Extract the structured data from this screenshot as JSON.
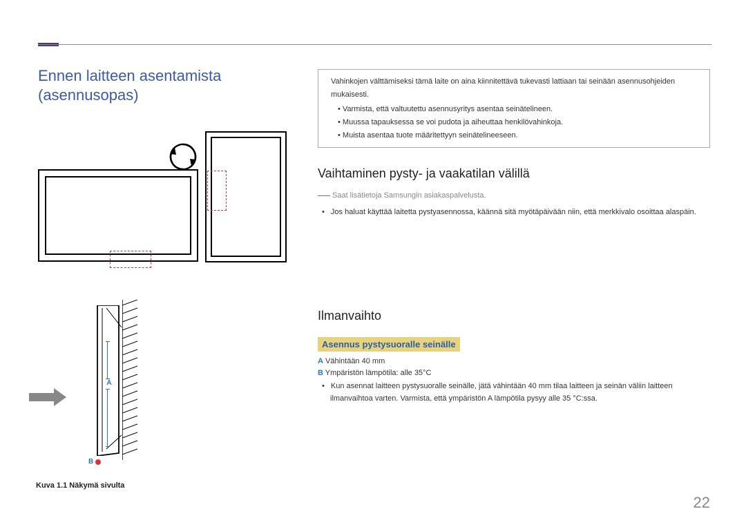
{
  "page": {
    "title": "Ennen laitteen asentamista (asennusopas)",
    "number": "22"
  },
  "left": {
    "labelA": "A",
    "labelB": "B",
    "caption": "Kuva 1.1 Näkymä sivulta"
  },
  "right": {
    "warn": {
      "main": "Vahinkojen välttämiseksi tämä laite on aina kiinnitettävä tukevasti lattiaan tai seinään asennusohjeiden mukaisesti.",
      "b1": "Varmista, että valtuutettu asennusyritys asentaa seinätelineen.",
      "b2": "Muussa tapauksessa se voi pudota ja aiheuttaa henkilövahinkoja.",
      "b3": "Muista asentaa tuote määritettyyn seinätelineeseen."
    },
    "sec1": {
      "h2": "Vaihtaminen pysty- ja vaakatilan välillä",
      "note": "Saat lisätietoja Samsungin asiakaspalvelusta.",
      "b1": "Jos haluat käyttää laitetta pystyasennossa, käännä sitä myötäpäivään niin, että merkkivalo osoittaa alaspäin."
    },
    "sec2": {
      "h2": "Ilmanvaihto",
      "sub": "Asennus pystysuoralle seinälle",
      "defA": " Vähintään 40 mm",
      "defB": " Ympäristön lämpötila: alle 35°C",
      "b1": "Kun asennat laitteen pystysuoralle seinälle, jätä vähintään 40 mm tilaa laitteen ja seinän väliin laitteen ilmanvaihtoa varten. Varmista, että ympäristön A lämpötila pysyy alle 35 °C:ssa."
    }
  }
}
